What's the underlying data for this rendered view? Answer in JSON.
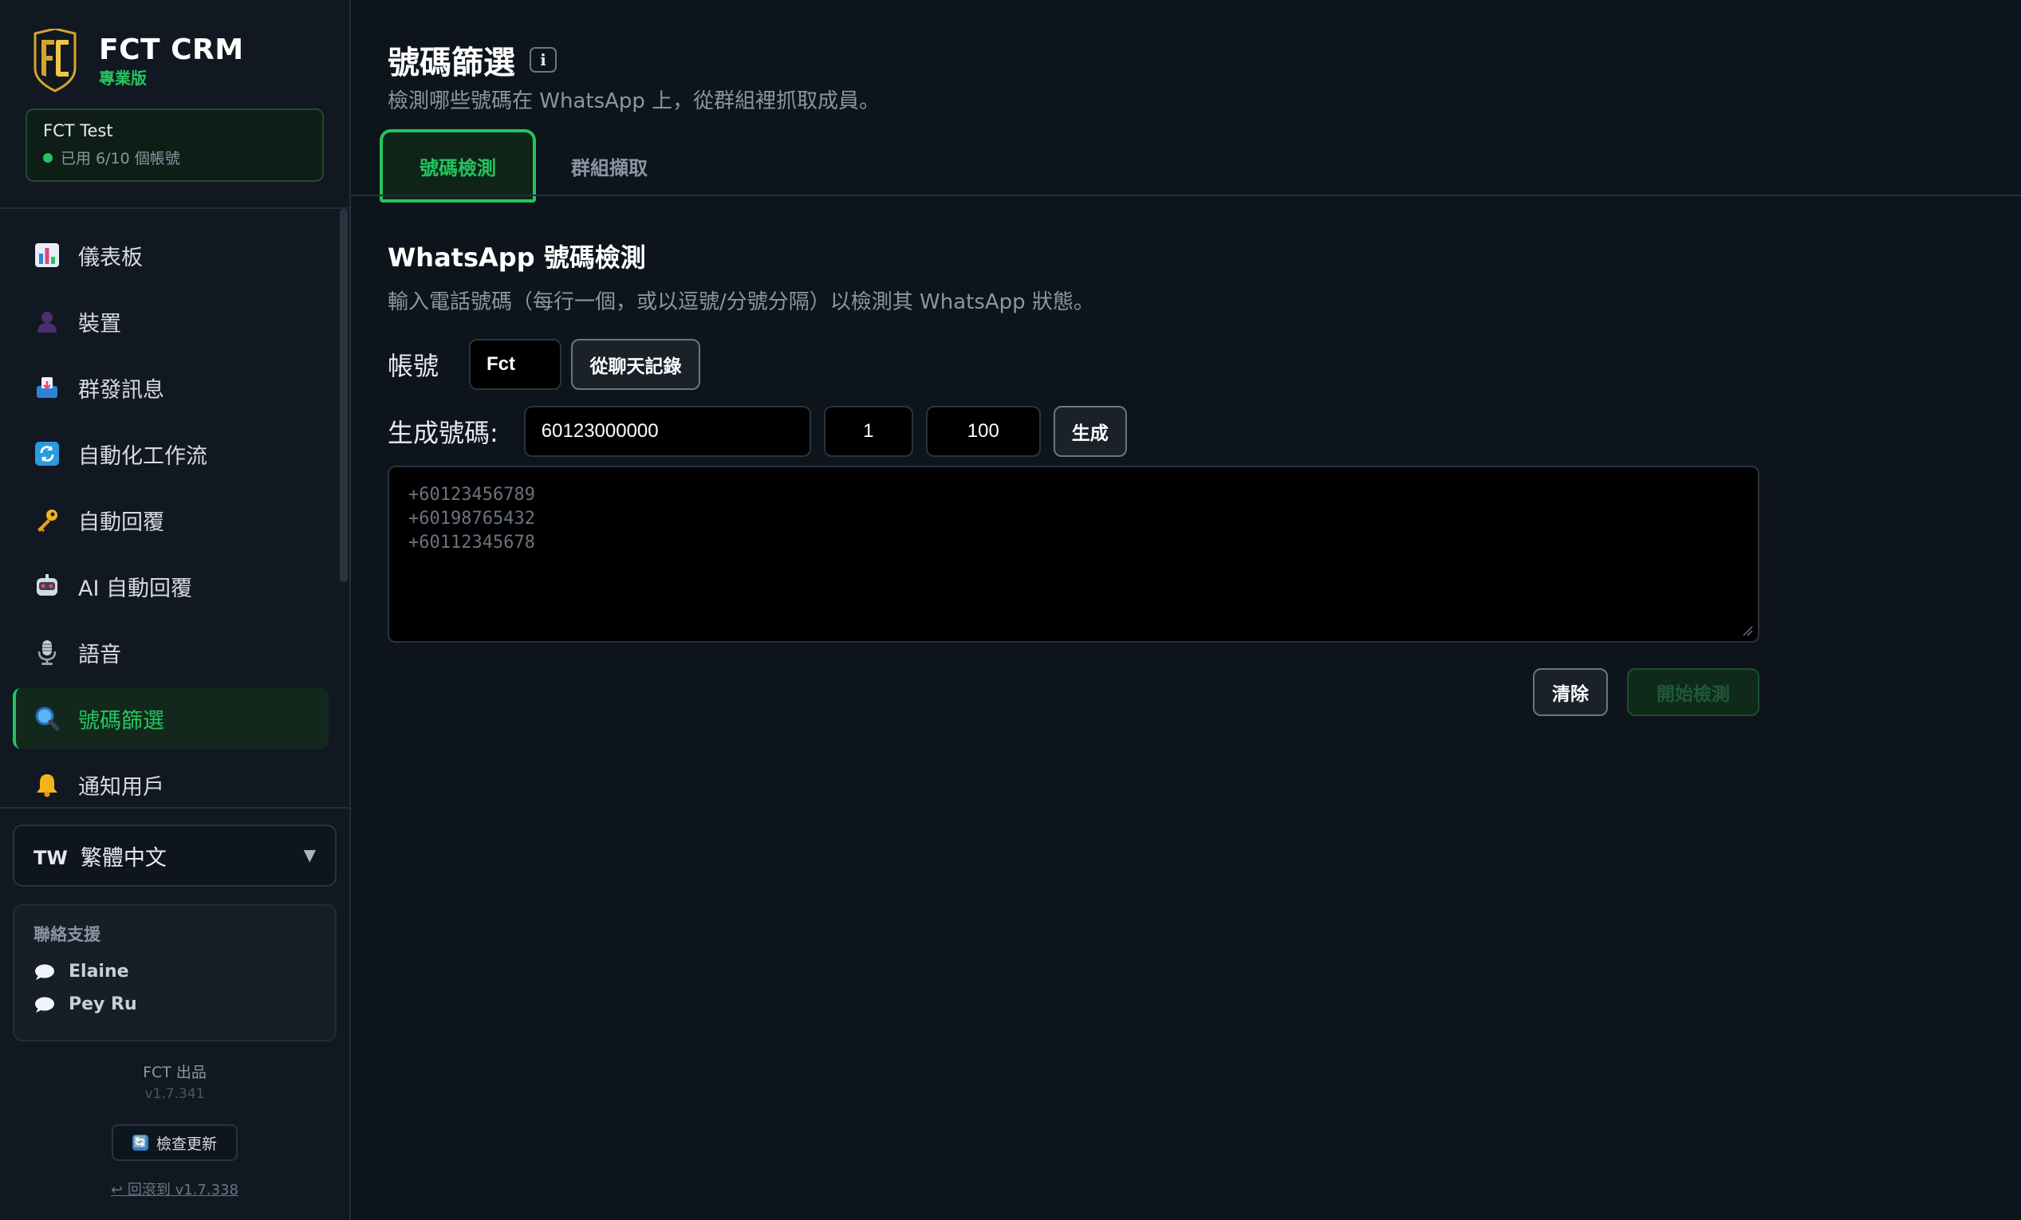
{
  "brand": {
    "title": "FCT CRM",
    "subtitle": "專業版"
  },
  "account_card": {
    "name": "FCT Test",
    "usage": "已用 6/10 個帳號"
  },
  "nav": {
    "items": [
      {
        "label": "儀表板",
        "icon": "chart-icon"
      },
      {
        "label": "裝置",
        "icon": "user-silhouette-icon"
      },
      {
        "label": "群發訊息",
        "icon": "inbox-tray-icon"
      },
      {
        "label": "自動化工作流",
        "icon": "refresh-icon"
      },
      {
        "label": "自動回覆",
        "icon": "key-icon"
      },
      {
        "label": "AI 自動回覆",
        "icon": "robot-icon"
      },
      {
        "label": "語音",
        "icon": "microphone-icon"
      },
      {
        "label": "號碼篩選",
        "icon": "magnifier-icon",
        "active": true
      },
      {
        "label": "通知用戶",
        "icon": "bell-icon"
      }
    ]
  },
  "language": {
    "code": "TW",
    "name": "繁體中文",
    "caret": "▼"
  },
  "support": {
    "title": "聯絡支援",
    "contacts": [
      "Elaine",
      "Pey Ru"
    ]
  },
  "footer": {
    "brand": "FCT 出品",
    "version": "v1.7.341",
    "update_label": "檢查更新",
    "update_icon": "🔄",
    "rollback": "↩ 回滾到 v1.7.338"
  },
  "page": {
    "title": "號碼篩選",
    "info_icon": "i",
    "subtitle": "檢測哪些號碼在 WhatsApp 上，從群組裡抓取成員。",
    "tabs": [
      {
        "label": "號碼檢測",
        "active": true
      },
      {
        "label": "群組擷取",
        "active": false
      }
    ]
  },
  "checker": {
    "title": "WhatsApp 號碼檢測",
    "subtitle": "輸入電話號碼（每行一個，或以逗號/分號分隔）以檢測其 WhatsApp 狀態。",
    "account_label": "帳號",
    "account_value": "Fct",
    "from_chat_button": "從聊天記錄",
    "generate_label": "生成號碼:",
    "generate_prefix": "60123000000",
    "generate_start": "1",
    "generate_count": "100",
    "generate_button": "生成",
    "textarea_placeholder": "+60123456789\n+60198765432\n+60112345678",
    "clear_button": "清除",
    "start_button": "開始檢測"
  },
  "colors": {
    "accent": "#22c55e",
    "background": "#0e141b",
    "sidebar": "#111821"
  }
}
